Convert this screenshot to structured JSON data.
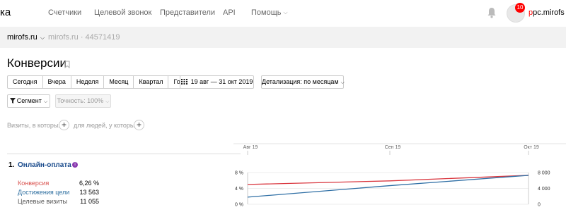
{
  "topbar": {
    "logo_fragment": "ка",
    "nav": [
      {
        "label": "Счетчики"
      },
      {
        "label": "Целевой звонок"
      },
      {
        "label": "Представители"
      },
      {
        "label": "API"
      },
      {
        "label": "Помощь"
      }
    ],
    "notifications_count": "10",
    "user": {
      "first_letter": "p",
      "rest": "pc.mirofs"
    }
  },
  "counter": {
    "name": "mirofs.ru",
    "info": "mirofs.ru · 44571419"
  },
  "page": {
    "title": "Конверсии"
  },
  "period_buttons": [
    "Сегодня",
    "Вчера",
    "Неделя",
    "Месяц",
    "Квартал",
    "Год"
  ],
  "date_range": "19 авг — 31 окт 2019",
  "detail": "Детализация: по месяцам",
  "segment": "Сегмент",
  "accuracy": "Точность: 100%",
  "filters": {
    "visits_text": "Визиты, в которых",
    "people_text": "для людей, у которых"
  },
  "goal": {
    "number": "1.",
    "name": "Онлайн-оплата",
    "info_icon": "i",
    "metrics": [
      {
        "label": "Конверсия",
        "value": "6,26 %",
        "color": "#d9534f"
      },
      {
        "label": "Достижения цели",
        "value": "13 563",
        "color": "#2e6fa0"
      },
      {
        "label": "Целевые визиты",
        "value": "11 055",
        "color": "#555555"
      }
    ]
  },
  "colors": {
    "conversion_line": "#d9363e",
    "achievements_line": "#2f6fa5"
  },
  "chart_data": {
    "type": "line",
    "x": [
      "Авг 19",
      "Сен 19",
      "Окт 19"
    ],
    "left_axis": {
      "ticks": [
        "8 %",
        "4 %",
        "0 %"
      ],
      "ylim": [
        0,
        8
      ]
    },
    "right_axis": {
      "ticks": [
        "8 000",
        "4 000",
        "0"
      ],
      "ylim": [
        0,
        8000
      ]
    },
    "series": [
      {
        "axis": "left",
        "color": "#d9363e",
        "values": [
          5.0,
          5.9,
          7.3
        ]
      },
      {
        "axis": "right",
        "color": "#2f6fa5",
        "values": [
          1800,
          4700,
          7300
        ]
      }
    ]
  }
}
